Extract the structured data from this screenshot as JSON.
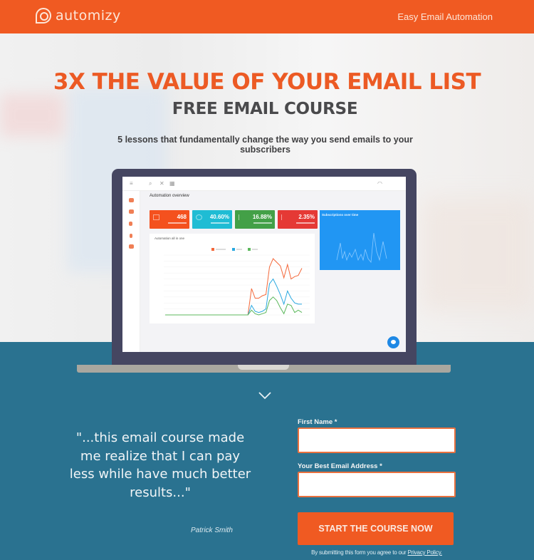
{
  "header": {
    "brand": "automizy",
    "tagline": "Easy Email Automation",
    "brand_color": "#f05a22"
  },
  "hero": {
    "headline": "3X THE VALUE OF YOUR EMAIL LIST",
    "subheadline": "FREE EMAIL COURSE",
    "description": "5 lessons that fundamentally change the way you send emails to your subscribers"
  },
  "dashboard_preview": {
    "title": "Automation overview",
    "stats": [
      {
        "value": "468",
        "color": "#f4511e"
      },
      {
        "value": "40.60%",
        "color": "#1fbcd4"
      },
      {
        "value": "16.88%",
        "color": "#43a047"
      },
      {
        "value": "2.35%",
        "color": "#e53935"
      }
    ],
    "chart_title": "Automation all in one",
    "subscriptions_title": "Subscriptions over time",
    "series_colors": [
      "#f4683a",
      "#29a8e0",
      "#5cb85c"
    ]
  },
  "testimonial": {
    "quote": "\"...this email course made me realize that I can pay less while have much better results...\"",
    "author": "Patrick Smith"
  },
  "form": {
    "first_name_label": "First Name *",
    "first_name_value": "",
    "email_label": "Your Best Email Address *",
    "email_value": "",
    "submit_label": "START THE COURSE NOW",
    "disclaimer": "By submitting this form you agree to our",
    "privacy_link": "Privacy Policy."
  },
  "colors": {
    "accent": "#f05a22",
    "section_bg": "#2a7290",
    "heading_dark": "#4a4a4c"
  }
}
